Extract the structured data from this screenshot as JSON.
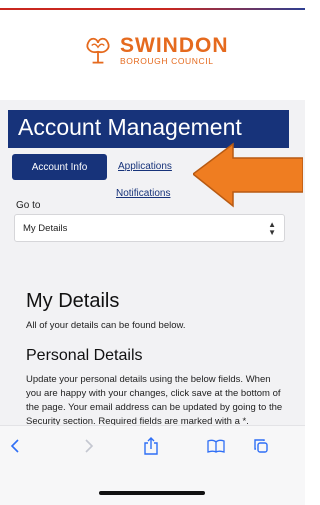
{
  "logo": {
    "name": "SWINDON",
    "subtitle": "BOROUGH COUNCIL"
  },
  "banner": {
    "title": "Account Management"
  },
  "tabs": {
    "account_info": "Account Info",
    "applications": "Applications",
    "notifications": "Notifications"
  },
  "goto": {
    "label": "Go to",
    "selected": "My Details"
  },
  "content": {
    "heading": "My Details",
    "subtitle": "All of your details can be found below.",
    "section_heading": "Personal Details",
    "section_text": "Update your personal details using the below fields. When you are happy with your changes, click save at the bottom of the page. Your email address can be updated by going to the Security section. Required fields are marked with a *."
  },
  "colors": {
    "brand_blue": "#17337a",
    "brand_orange": "#e56a1e",
    "arrow_orange": "#ef7d21",
    "toolbar_blue": "#2f6ff6"
  },
  "toolbar": {
    "icons": [
      "back-icon",
      "forward-icon",
      "share-icon",
      "bookmarks-icon",
      "tabs-icon"
    ]
  }
}
